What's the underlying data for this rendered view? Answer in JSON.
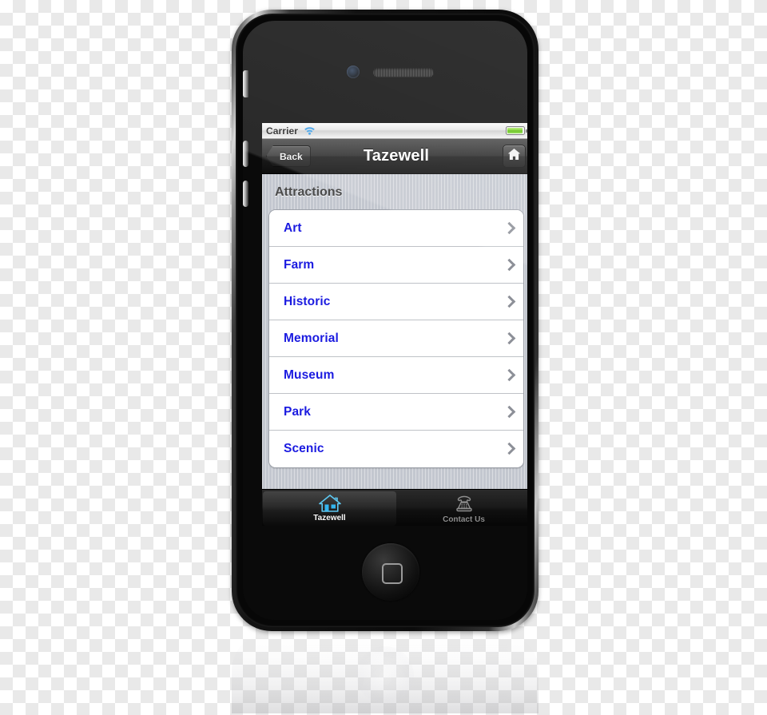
{
  "device": {
    "name": "iPhone",
    "hardware": {
      "camera": "front-camera",
      "speaker": "earpiece-speaker",
      "home_button": "home-button",
      "silent_switch": "silent-switch",
      "volume_up": "volume-up-button",
      "volume_down": "volume-down-button"
    }
  },
  "statusbar": {
    "carrier": "Carrier",
    "wifi_icon": "wifi-icon",
    "battery_icon": "battery-icon",
    "battery_color": "#6ecb1a"
  },
  "navbar": {
    "back_label": "Back",
    "title": "Tazewell",
    "home_icon": "home-icon"
  },
  "content": {
    "section_title": "Attractions",
    "link_color": "#1b1be0",
    "rows": [
      {
        "label": "Art",
        "chevron": "chevron-right-icon"
      },
      {
        "label": "Farm",
        "chevron": "chevron-right-icon"
      },
      {
        "label": "Historic",
        "chevron": "chevron-right-icon"
      },
      {
        "label": "Memorial",
        "chevron": "chevron-right-icon"
      },
      {
        "label": "Museum",
        "chevron": "chevron-right-icon"
      },
      {
        "label": "Park",
        "chevron": "chevron-right-icon"
      },
      {
        "label": "Scenic",
        "chevron": "chevron-right-icon"
      }
    ]
  },
  "tabbar": {
    "tabs": [
      {
        "label": "Tazewell",
        "icon": "house-icon",
        "active": true,
        "accent": "#4ec3f0"
      },
      {
        "label": "Contact Us",
        "icon": "telephone-icon",
        "active": false,
        "accent": "#8e8e8e"
      }
    ]
  }
}
